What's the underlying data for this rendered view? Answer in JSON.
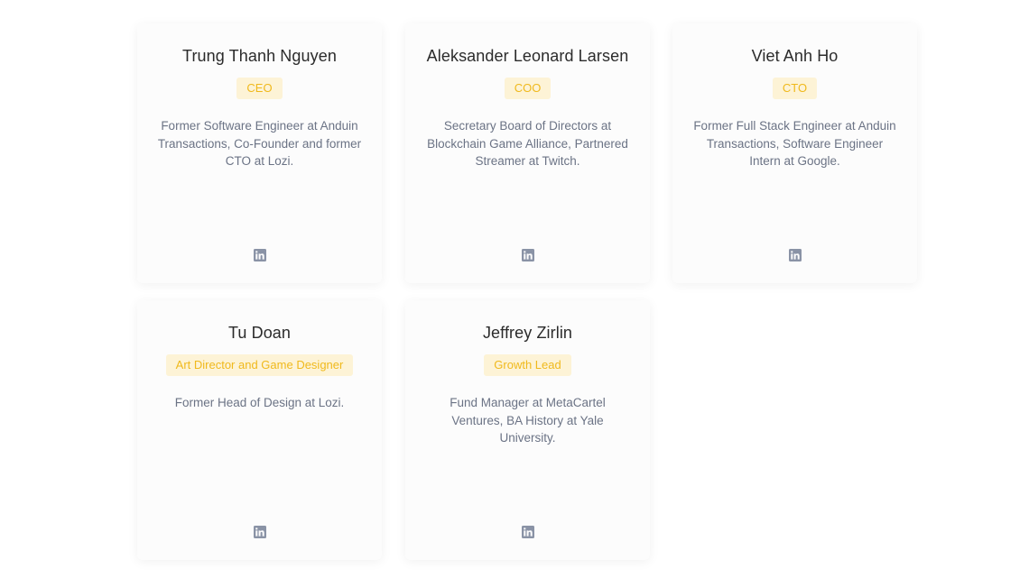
{
  "team": [
    {
      "name": "Trung Thanh Nguyen",
      "role": "CEO",
      "bio": "Former Software Engineer at Anduin Transactions, Co-Founder and former CTO at Lozi.",
      "icon": "linkedin-icon"
    },
    {
      "name": "Aleksander Leonard Larsen",
      "role": "COO",
      "bio": "Secretary Board of Directors at Blockchain Game Alliance, Partnered Streamer at Twitch.",
      "icon": "linkedin-icon"
    },
    {
      "name": "Viet Anh Ho",
      "role": "CTO",
      "bio": "Former Full Stack Engineer at Anduin Transactions, Software Engineer Intern at Google.",
      "icon": "linkedin-icon"
    },
    {
      "name": "Tu Doan",
      "role": "Art Director and Game Designer",
      "bio": "Former Head of Design at Lozi.",
      "icon": "linkedin-icon"
    },
    {
      "name": "Jeffrey Zirlin",
      "role": "Growth Lead",
      "bio": "Fund Manager at MetaCartel Ventures, BA History at Yale University.",
      "icon": "linkedin-icon"
    }
  ],
  "colors": {
    "badge_bg": "#fdf3d6",
    "badge_text": "#f0b91c",
    "name_text": "#2b2b2b",
    "bio_text": "#6b7385",
    "icon": "#8a93a6"
  }
}
